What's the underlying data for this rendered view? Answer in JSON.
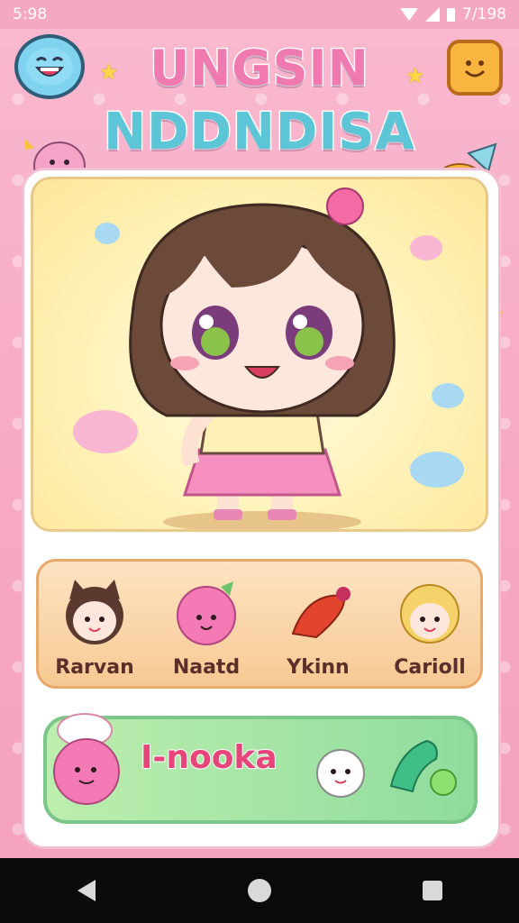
{
  "status_bar": {
    "time": "5:98",
    "right_text": "7/198"
  },
  "title": {
    "line1": "UNGSIN",
    "line2": "NDDNDISA"
  },
  "choices": [
    {
      "label": "Rarvan",
      "icon": "cat-girl-icon"
    },
    {
      "label": "Naatd",
      "icon": "pink-blob-icon"
    },
    {
      "label": "Ykinn",
      "icon": "red-pepper-icon"
    },
    {
      "label": "Carioll",
      "icon": "blonde-girl-icon"
    }
  ],
  "action": {
    "label": "I-nooka"
  },
  "icons": {
    "top_left": "laughing-face-icon",
    "top_right": "smiley-face-icon"
  },
  "colors": {
    "background": "#f7a8c3",
    "portrait_bg": "#fff2b8",
    "choices_bg": "#f7c993",
    "action_bg": "#8fdc9d",
    "accent": "#e7447a"
  }
}
